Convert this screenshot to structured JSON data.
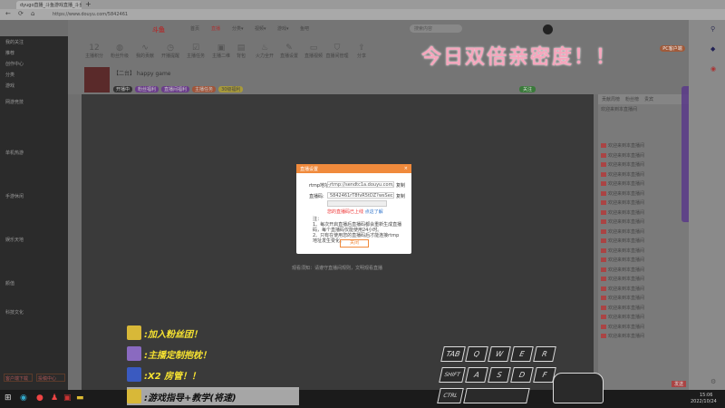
{
  "browser": {
    "tab_title": "dyugo直播_斗鱼游戏直播_斗鱼直",
    "url": "https://www.douyu.com/5842461"
  },
  "site": {
    "logo": "斗鱼",
    "nav": [
      "首页",
      "直播",
      "分类▾",
      "视频▾",
      "游戏▾",
      "鱼吧"
    ],
    "search_placeholder": "搜索内容",
    "user_icons": [
      "历史",
      "关注",
      "下载",
      "客户端",
      "消息",
      "创作中心"
    ]
  },
  "features": [
    {
      "top": "12",
      "label": "主播积分"
    },
    {
      "label": "粉丝升级"
    },
    {
      "label": "我的贡献"
    },
    {
      "label": "开播提醒"
    },
    {
      "label": "主播任务"
    },
    {
      "label": "主播二维"
    },
    {
      "label": "背包"
    },
    {
      "label": "火力全开"
    },
    {
      "label": "直播设置"
    },
    {
      "label": "直播视频"
    },
    {
      "label": "直播间管理"
    },
    {
      "label": "分享"
    }
  ],
  "sidebar": {
    "items": [
      "我的关注",
      "推荐",
      "创作中心",
      "分类",
      "游戏",
      "娱乐"
    ],
    "sections": [
      "网游竞技",
      "单机热游",
      "手游休闲",
      "娱乐天地",
      "颜值",
      "科技文化"
    ],
    "buttons": [
      "客户端下载",
      "投稿中心"
    ]
  },
  "room": {
    "title": "【二台】 happy game",
    "badges": [
      "开播中",
      "粉丝福利",
      "直播间福利",
      "主播任务",
      "30级福利"
    ],
    "fans_button": "关注",
    "pc_button": "PC客户端"
  },
  "overlay": {
    "headline": "今日双倍亲密度！！",
    "promos": [
      ":加入粉丝团！",
      ":主播定制抱枕！",
      ":X2 房管！！",
      ":游戏指导+教学(将速)"
    ],
    "keys": [
      "TAB",
      "Q",
      "W",
      "E",
      "R",
      "SHIFT",
      "A",
      "S",
      "D",
      "F",
      "CTRL"
    ]
  },
  "dialog": {
    "title": "直播设置",
    "rtmp_label": "rtmp地址:",
    "rtmp_value": "rtmp://sendtc1a.douyu.com/live",
    "code_label": "直播码:",
    "code_value": "5842461rT8fvR5tDZ?wsSecret=********",
    "copy": "复制",
    "warning": "您的直播码已上线",
    "link": "点这了解",
    "note_title": "注：",
    "notes": [
      "1、每次开启直播后直播码都会重新生成直播码，每个直播码仅能使用24小时。",
      "2、只有在使用您的直播码后才能连接rtmp地址发生变化。"
    ],
    "close": "关闭"
  },
  "below_dialog": "观看须知：请遵守直播间规则，文明观看直播",
  "chat": {
    "tabs": [
      "贡献周榜",
      "粉丝榜",
      "贵宾",
      "守护"
    ],
    "notice": "欢迎来到本直播间",
    "messages": [
      "欢迎来到本直播间",
      "欢迎来到本直播间",
      "欢迎来到本直播间",
      "欢迎来到本直播间",
      "欢迎来到本直播间",
      "欢迎来到本直播间",
      "欢迎来到本直播间",
      "欢迎来到本直播间",
      "欢迎来到本直播间",
      "欢迎来到本直播间",
      "欢迎来到本直播间",
      "欢迎来到本直播间",
      "欢迎来到本直播间",
      "欢迎来到本直播间",
      "欢迎来到本直播间",
      "欢迎来到本直播间",
      "欢迎来到本直播间",
      "欢迎来到本直播间",
      "欢迎来到本直播间",
      "欢迎来到本直播间",
      "欢迎来到本直播间"
    ],
    "send": "发送"
  },
  "taskbar": {
    "time": "15:06",
    "date": "2022/10/24"
  }
}
